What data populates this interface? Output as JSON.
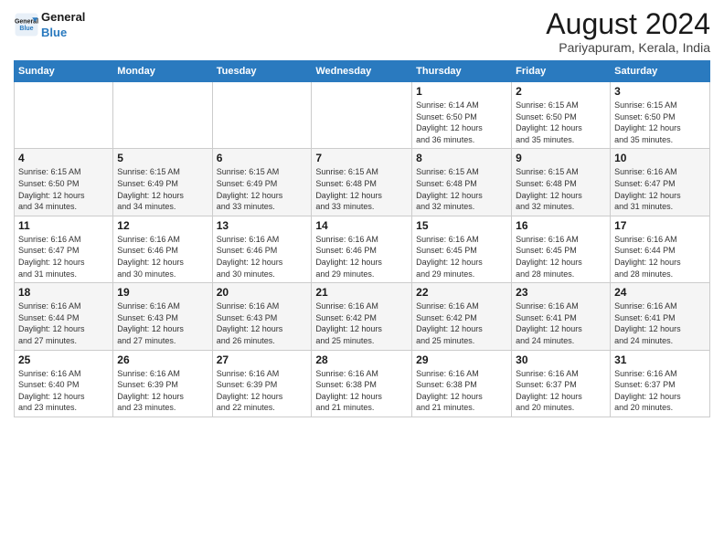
{
  "header": {
    "logo_line1": "General",
    "logo_line2": "Blue",
    "month_year": "August 2024",
    "location": "Pariyapuram, Kerala, India"
  },
  "days_of_week": [
    "Sunday",
    "Monday",
    "Tuesday",
    "Wednesday",
    "Thursday",
    "Friday",
    "Saturday"
  ],
  "weeks": [
    {
      "days": [
        {
          "num": "",
          "info": ""
        },
        {
          "num": "",
          "info": ""
        },
        {
          "num": "",
          "info": ""
        },
        {
          "num": "",
          "info": ""
        },
        {
          "num": "1",
          "info": "Sunrise: 6:14 AM\nSunset: 6:50 PM\nDaylight: 12 hours\nand 36 minutes."
        },
        {
          "num": "2",
          "info": "Sunrise: 6:15 AM\nSunset: 6:50 PM\nDaylight: 12 hours\nand 35 minutes."
        },
        {
          "num": "3",
          "info": "Sunrise: 6:15 AM\nSunset: 6:50 PM\nDaylight: 12 hours\nand 35 minutes."
        }
      ]
    },
    {
      "days": [
        {
          "num": "4",
          "info": "Sunrise: 6:15 AM\nSunset: 6:50 PM\nDaylight: 12 hours\nand 34 minutes."
        },
        {
          "num": "5",
          "info": "Sunrise: 6:15 AM\nSunset: 6:49 PM\nDaylight: 12 hours\nand 34 minutes."
        },
        {
          "num": "6",
          "info": "Sunrise: 6:15 AM\nSunset: 6:49 PM\nDaylight: 12 hours\nand 33 minutes."
        },
        {
          "num": "7",
          "info": "Sunrise: 6:15 AM\nSunset: 6:48 PM\nDaylight: 12 hours\nand 33 minutes."
        },
        {
          "num": "8",
          "info": "Sunrise: 6:15 AM\nSunset: 6:48 PM\nDaylight: 12 hours\nand 32 minutes."
        },
        {
          "num": "9",
          "info": "Sunrise: 6:15 AM\nSunset: 6:48 PM\nDaylight: 12 hours\nand 32 minutes."
        },
        {
          "num": "10",
          "info": "Sunrise: 6:16 AM\nSunset: 6:47 PM\nDaylight: 12 hours\nand 31 minutes."
        }
      ]
    },
    {
      "days": [
        {
          "num": "11",
          "info": "Sunrise: 6:16 AM\nSunset: 6:47 PM\nDaylight: 12 hours\nand 31 minutes."
        },
        {
          "num": "12",
          "info": "Sunrise: 6:16 AM\nSunset: 6:46 PM\nDaylight: 12 hours\nand 30 minutes."
        },
        {
          "num": "13",
          "info": "Sunrise: 6:16 AM\nSunset: 6:46 PM\nDaylight: 12 hours\nand 30 minutes."
        },
        {
          "num": "14",
          "info": "Sunrise: 6:16 AM\nSunset: 6:46 PM\nDaylight: 12 hours\nand 29 minutes."
        },
        {
          "num": "15",
          "info": "Sunrise: 6:16 AM\nSunset: 6:45 PM\nDaylight: 12 hours\nand 29 minutes."
        },
        {
          "num": "16",
          "info": "Sunrise: 6:16 AM\nSunset: 6:45 PM\nDaylight: 12 hours\nand 28 minutes."
        },
        {
          "num": "17",
          "info": "Sunrise: 6:16 AM\nSunset: 6:44 PM\nDaylight: 12 hours\nand 28 minutes."
        }
      ]
    },
    {
      "days": [
        {
          "num": "18",
          "info": "Sunrise: 6:16 AM\nSunset: 6:44 PM\nDaylight: 12 hours\nand 27 minutes."
        },
        {
          "num": "19",
          "info": "Sunrise: 6:16 AM\nSunset: 6:43 PM\nDaylight: 12 hours\nand 27 minutes."
        },
        {
          "num": "20",
          "info": "Sunrise: 6:16 AM\nSunset: 6:43 PM\nDaylight: 12 hours\nand 26 minutes."
        },
        {
          "num": "21",
          "info": "Sunrise: 6:16 AM\nSunset: 6:42 PM\nDaylight: 12 hours\nand 25 minutes."
        },
        {
          "num": "22",
          "info": "Sunrise: 6:16 AM\nSunset: 6:42 PM\nDaylight: 12 hours\nand 25 minutes."
        },
        {
          "num": "23",
          "info": "Sunrise: 6:16 AM\nSunset: 6:41 PM\nDaylight: 12 hours\nand 24 minutes."
        },
        {
          "num": "24",
          "info": "Sunrise: 6:16 AM\nSunset: 6:41 PM\nDaylight: 12 hours\nand 24 minutes."
        }
      ]
    },
    {
      "days": [
        {
          "num": "25",
          "info": "Sunrise: 6:16 AM\nSunset: 6:40 PM\nDaylight: 12 hours\nand 23 minutes."
        },
        {
          "num": "26",
          "info": "Sunrise: 6:16 AM\nSunset: 6:39 PM\nDaylight: 12 hours\nand 23 minutes."
        },
        {
          "num": "27",
          "info": "Sunrise: 6:16 AM\nSunset: 6:39 PM\nDaylight: 12 hours\nand 22 minutes."
        },
        {
          "num": "28",
          "info": "Sunrise: 6:16 AM\nSunset: 6:38 PM\nDaylight: 12 hours\nand 21 minutes."
        },
        {
          "num": "29",
          "info": "Sunrise: 6:16 AM\nSunset: 6:38 PM\nDaylight: 12 hours\nand 21 minutes."
        },
        {
          "num": "30",
          "info": "Sunrise: 6:16 AM\nSunset: 6:37 PM\nDaylight: 12 hours\nand 20 minutes."
        },
        {
          "num": "31",
          "info": "Sunrise: 6:16 AM\nSunset: 6:37 PM\nDaylight: 12 hours\nand 20 minutes."
        }
      ]
    }
  ]
}
